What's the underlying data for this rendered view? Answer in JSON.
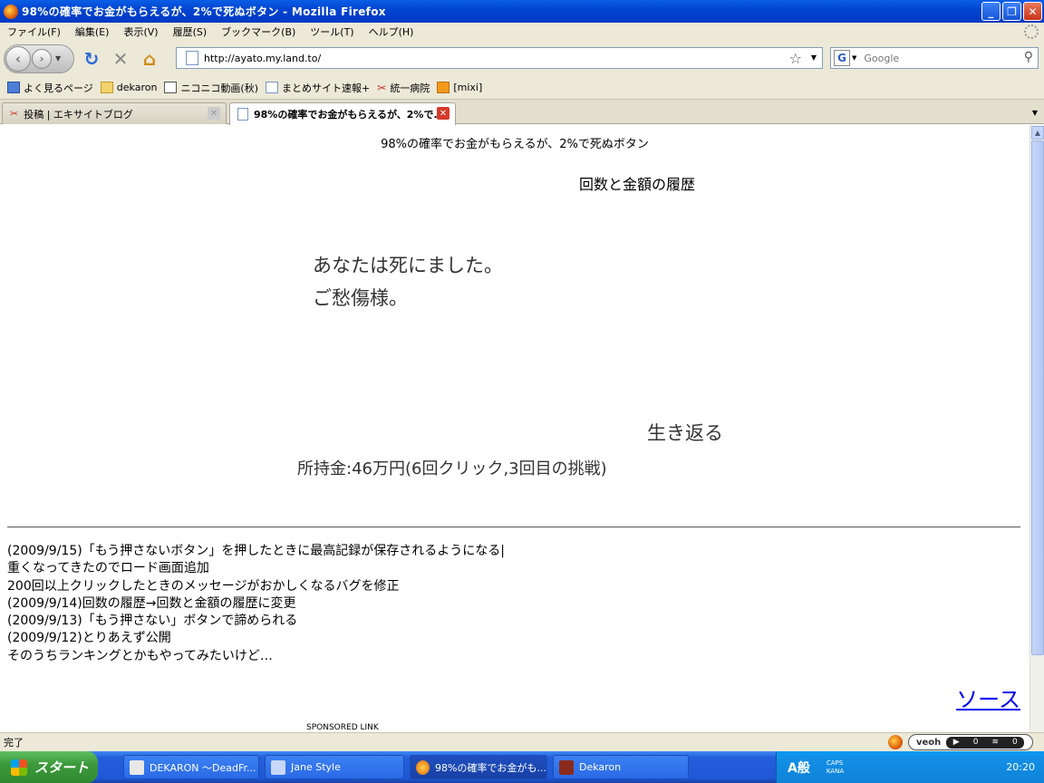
{
  "window": {
    "title": "98%の確率でお金がもらえるが、2%で死ぬボタン - Mozilla Firefox"
  },
  "menu": [
    "ファイル(F)",
    "編集(E)",
    "表示(V)",
    "履歴(S)",
    "ブックマーク(B)",
    "ツール(T)",
    "ヘルプ(H)"
  ],
  "nav": {
    "url": "http://ayato.my.land.to/",
    "search_placeholder": "Google",
    "search_engine_icon": "G"
  },
  "bookmarks": [
    "よく見るページ",
    "dekaron",
    "ニコニコ動画(秋)",
    "まとめサイト速報+",
    "統一病院",
    "[mixi]"
  ],
  "tabs": [
    {
      "label": "投稿 | エキサイトブログ"
    },
    {
      "label": "98%の確率でお金がもらえるが、2%で..."
    }
  ],
  "page": {
    "heading": "98%の確率でお金がもらえるが、2%で死ぬボタン",
    "history_link": "回数と金額の履歴",
    "death_line1": "あなたは死にました。",
    "death_line2": "ご愁傷様。",
    "revive_button": "生き返る",
    "money": "所持金:46万円(6回クリック,3回目の挑戦)",
    "changelog": [
      "(2009/9/15)「もう押さないボタン」を押したときに最高記録が保存されるようになる|",
      "重くなってきたのでロード画面追加",
      "200回以上クリックしたときのメッセージがおかしくなるバグを修正",
      "(2009/9/14)回数の履歴→回数と金額の履歴に変更",
      "(2009/9/13)「もう押さない」ボタンで諦められる",
      "(2009/9/12)とりあえず公開",
      "そのうちランキングとかもやってみたいけど…"
    ],
    "source_link": "ソース",
    "sponsored": "SPONSORED LINK"
  },
  "status": {
    "text": "完了",
    "veoh_logo": "veoh",
    "veoh_count1": "0",
    "veoh_count2": "0"
  },
  "taskbar": {
    "start_label": "スタート",
    "tasks": [
      {
        "label": "DEKARON ～DeadFr..."
      },
      {
        "label": "Jane Style"
      },
      {
        "label": "98%の確率でお金がも..."
      },
      {
        "label": "Dekaron"
      }
    ],
    "ime": "A般",
    "caps": "CAPS",
    "kana": "KANA",
    "clock": "20:20"
  },
  "colors": {
    "link": "#0000ee",
    "titlebar": "#0245d0",
    "tab_close": "#d6392a"
  }
}
